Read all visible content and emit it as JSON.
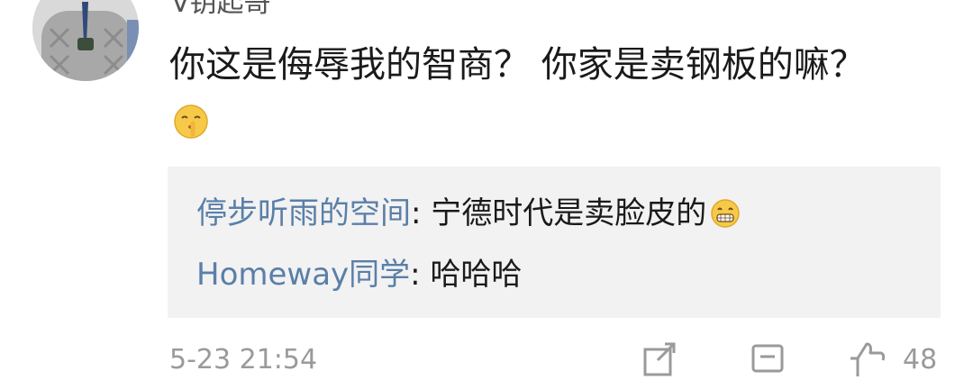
{
  "comment": {
    "username": "V钥起哥",
    "text": "你这是侮辱我的智商？ 你家是卖钢板的嘛？",
    "emoji_icon": "shush-face-emoji"
  },
  "replies": [
    {
      "author": "停步听雨的空间",
      "separator": ": ",
      "text": "宁德时代是卖脸皮的",
      "emoji_icon": "grin-emoji"
    },
    {
      "author": "Homeway同学",
      "separator": ": ",
      "text": "哈哈哈"
    }
  ],
  "footer": {
    "timestamp": "5-23 21:54",
    "like_count": "48"
  },
  "colors": {
    "reply_author": "#5a7fa8",
    "reply_bg": "#f2f2f2",
    "meta_gray": "#9a9a9a"
  }
}
